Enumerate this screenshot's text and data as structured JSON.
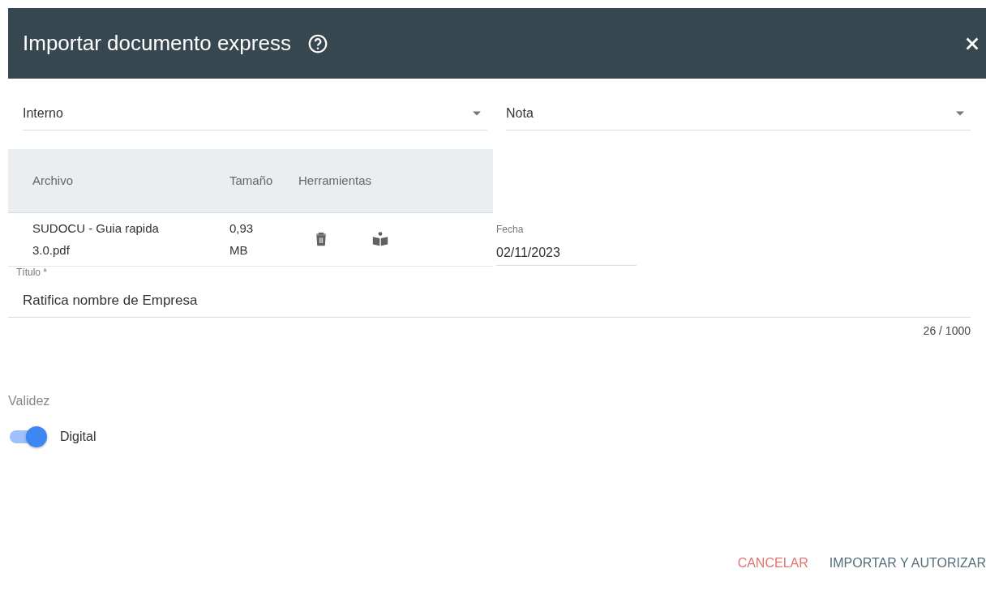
{
  "dialog": {
    "title": "Importar documento express"
  },
  "selects": [
    {
      "value": "Interno"
    },
    {
      "value": "Nota"
    }
  ],
  "table": {
    "columns": [
      "Archivo",
      "Tamaño",
      "Herramientas"
    ],
    "rows": [
      {
        "file": "SUDOCU - Guia rapida 3.0.pdf",
        "size": "0,93 MB"
      }
    ]
  },
  "date_field": {
    "label": "Fecha",
    "value": "02/11/2023"
  },
  "title_field": {
    "label": "Título *",
    "value": "Ratifica nombre de Empresa",
    "counter": "26 / 1000"
  },
  "validity": {
    "label": "Validez",
    "toggle": {
      "label": "Digital",
      "on": true
    }
  },
  "buttons": [
    {
      "label": "CANCELAR",
      "kind": "cancel"
    },
    {
      "label": "IMPORTAR Y AUTORIZAR",
      "kind": "primary"
    }
  ]
}
